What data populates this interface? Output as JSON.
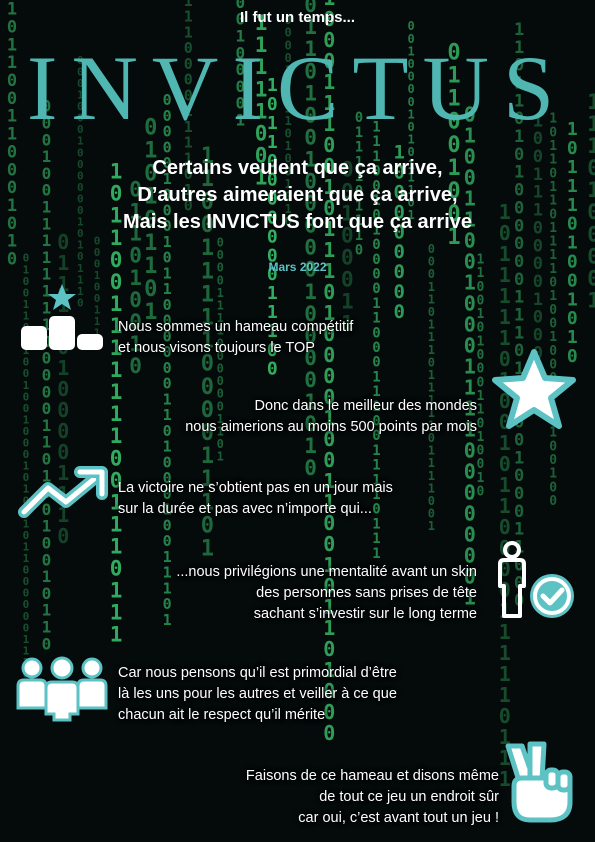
{
  "header": {
    "intro": "Il fut un temps...",
    "title": "INVICTUS",
    "motto": [
      "Certains veulent que ça arrive,",
      "D’autres aimeraient que ça arrive,",
      "Mais les INVICTUS font que ça arrive"
    ],
    "date": "Mars 2022"
  },
  "sections": [
    {
      "icon": "podium-star-icon",
      "lines": [
        "Nous sommes un hameau compétitif",
        "et nous visons toujours le TOP"
      ]
    },
    {
      "icon": "star-icon",
      "lines": [
        "Donc dans le meilleur des mondes",
        "nous aimerions au moins 500 points par mois"
      ]
    },
    {
      "icon": "trend-up-icon",
      "lines": [
        "La victoire ne s’obtient pas en un jour mais",
        "sur la durée et pas avec n’importe qui..."
      ]
    },
    {
      "icon": "person-check-icon",
      "lines": [
        "...nous privilégions une mentalité avant un skin",
        "des personnes sans prises de tête",
        "sachant s’investir sur le long terme"
      ]
    },
    {
      "icon": "team-icon",
      "lines": [
        "Car nous pensons qu’il est primordial d’être",
        "là les uns pour les autres et veiller à ce que",
        "chacun ait le respect qu’il mérite"
      ]
    },
    {
      "icon": "victory-hand-icon",
      "lines": [
        "Faisons de ce hameau et disons même",
        "de tout ce jeu un endroit sûr",
        "car oui, c’est avant tout un jeu !"
      ]
    }
  ],
  "colors": {
    "background": "#050a0b",
    "accent": "#4fb6b2",
    "matrix_green": "#3fe07a",
    "text": "#ffffff"
  }
}
